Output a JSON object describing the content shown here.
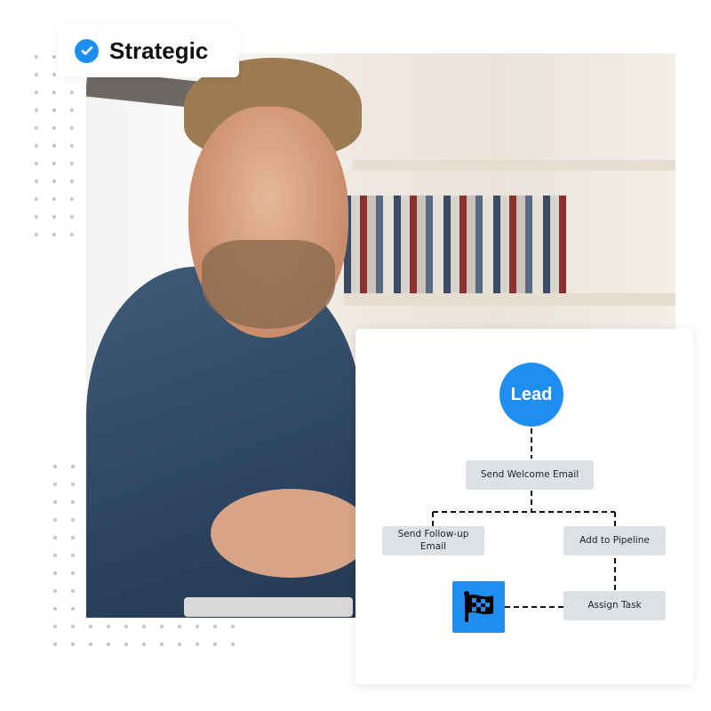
{
  "badge": {
    "label": "Strategic",
    "icon": "check-circle-icon",
    "color": "#1f8ef1"
  },
  "workflow": {
    "start": "Lead",
    "nodes": {
      "welcome": "Send Welcome Email",
      "followup": "Send Follow-up Email",
      "pipeline": "Add to Pipeline",
      "task": "Assign Task"
    },
    "end_icon": "checkered-flag-icon",
    "accent": "#1f8ef1"
  }
}
